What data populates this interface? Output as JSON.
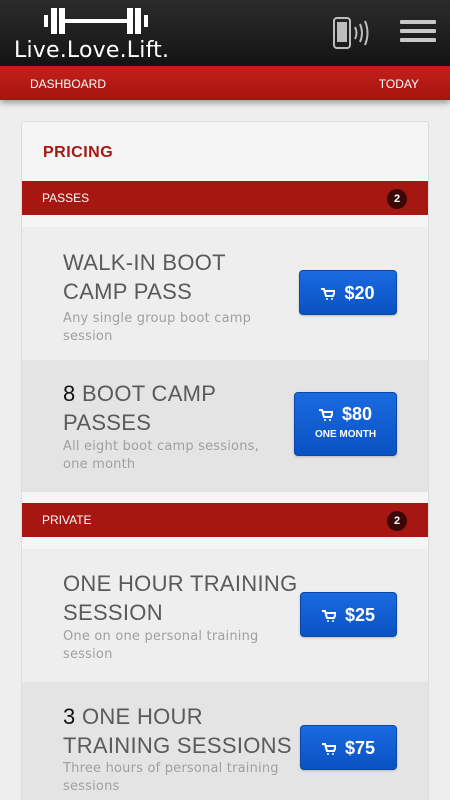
{
  "header": {
    "logo_text": "Live.Love.Lift."
  },
  "nav": {
    "left": "DASHBOARD",
    "right": "TODAY"
  },
  "card": {
    "title": "PRICING"
  },
  "sections": [
    {
      "label": "PASSES",
      "count": "2",
      "items": [
        {
          "qty": "",
          "title": "WALK-IN BOOT CAMP PASS",
          "desc": "Any single group boot camp session",
          "price": "$20",
          "sub": ""
        },
        {
          "qty": "8",
          "title": " BOOT CAMP PASSES",
          "desc": "All eight boot camp sessions, one month",
          "price": "$80",
          "sub": "ONE MONTH"
        }
      ]
    },
    {
      "label": "PRIVATE",
      "count": "2",
      "items": [
        {
          "qty": "",
          "title": "ONE HOUR TRAINING SESSION",
          "desc": "One on one personal training session",
          "price": "$25",
          "sub": ""
        },
        {
          "qty": "3",
          "title": " ONE HOUR TRAINING SESSIONS",
          "desc": "Three hours of personal training sessions",
          "price": "$75",
          "sub": ""
        }
      ]
    }
  ],
  "icons": {
    "logo": "barbell-icon",
    "phone": "phone-vibrate-icon",
    "menu": "hamburger-menu-icon",
    "cart": "cart-icon"
  },
  "colors": {
    "header": "#1c1c1c",
    "accent_red": "#a61711",
    "button_blue": "#0a52c3"
  }
}
